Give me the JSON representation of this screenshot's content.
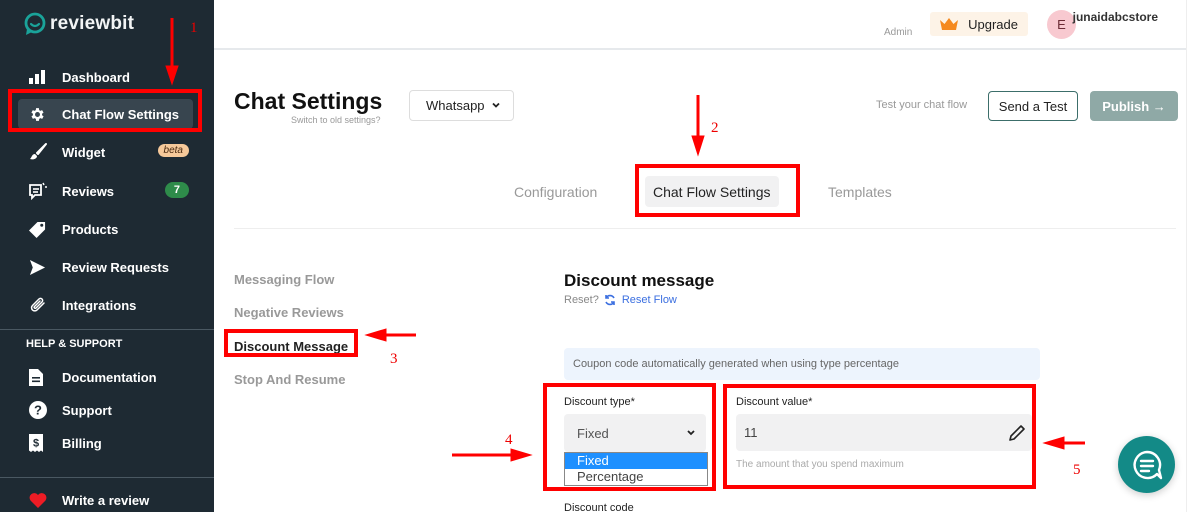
{
  "brand": {
    "name": "reviewbit",
    "accent": "#1aa39a"
  },
  "sidebar": {
    "items": [
      {
        "label": "Dashboard",
        "icon": "bar-chart-icon"
      },
      {
        "label": "Chat Flow Settings",
        "icon": "gear-icon",
        "active": true
      },
      {
        "label": "Widget",
        "icon": "brush-icon",
        "badge": "beta"
      },
      {
        "label": "Reviews",
        "icon": "reviews-icon",
        "badge": "7"
      },
      {
        "label": "Products",
        "icon": "tag-icon"
      },
      {
        "label": "Review Requests",
        "icon": "send-icon"
      },
      {
        "label": "Integrations",
        "icon": "paperclip-icon"
      }
    ],
    "help_title": "HELP & SUPPORT",
    "help_items": [
      {
        "label": "Documentation",
        "icon": "document-icon"
      },
      {
        "label": "Support",
        "icon": "question-icon"
      },
      {
        "label": "Billing",
        "icon": "receipt-icon"
      }
    ],
    "write_review": {
      "label": "Write a review",
      "icon": "heart-icon"
    }
  },
  "topbar": {
    "upgrade_label": "Upgrade",
    "user": {
      "initial": "E",
      "name": "junaidabcstore",
      "role": "Admin"
    }
  },
  "header": {
    "title": "Chat Settings",
    "switch_link": "Switch to old settings?",
    "channel": "Whatsapp",
    "test_label": "Test your chat flow",
    "send_test_label": "Send a Test",
    "publish_label": "Publish →"
  },
  "tabs": [
    {
      "label": "Configuration"
    },
    {
      "label": "Chat Flow Settings",
      "active": true
    },
    {
      "label": "Templates"
    }
  ],
  "subnav": [
    {
      "label": "Messaging Flow"
    },
    {
      "label": "Negative Reviews"
    },
    {
      "label": "Discount Message",
      "active": true
    },
    {
      "label": "Stop And Resume"
    }
  ],
  "content": {
    "heading": "Discount message",
    "reset_prefix": "Reset?",
    "reset_link": "Reset Flow",
    "info": "Coupon code automatically generated when using type percentage",
    "discount_type": {
      "label": "Discount type*",
      "value": "Fixed",
      "options": [
        "Fixed",
        "Percentage"
      ],
      "selected_option": "Fixed"
    },
    "discount_value": {
      "label": "Discount value*",
      "value": "11",
      "helper": "The amount that you spend maximum"
    },
    "discount_code_label": "Discount code"
  },
  "annotations": [
    "1",
    "2",
    "3",
    "4",
    "5"
  ]
}
